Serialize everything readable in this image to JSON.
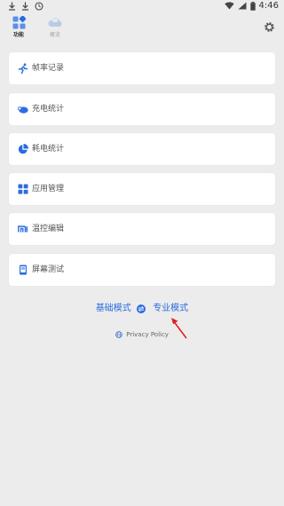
{
  "status_bar": {
    "time": "4:46",
    "notifications": [
      "download-icon",
      "download-icon",
      "clock-icon"
    ]
  },
  "tabs": [
    {
      "label": "功能",
      "icon": "grid-icon",
      "active": true
    },
    {
      "label": "概览",
      "icon": "cloud-icon",
      "active": false
    }
  ],
  "menu": [
    {
      "label": "帧率记录",
      "icon": "running-icon"
    },
    {
      "label": "充电统计",
      "icon": "battery-cloud-icon"
    },
    {
      "label": "耗电统计",
      "icon": "pie-chart-icon"
    },
    {
      "label": "应用管理",
      "icon": "apps-grid-icon"
    },
    {
      "label": "温控编辑",
      "icon": "mi-icon"
    },
    {
      "label": "屏幕测试",
      "icon": "phone-screen-icon"
    }
  ],
  "mode": {
    "basic_label": "基础模式",
    "pro_label": "专业模式"
  },
  "privacy": {
    "label": "Privacy Policy"
  },
  "colors": {
    "accent": "#2a6de0",
    "background": "#ececec",
    "card": "#ffffff",
    "annotation": "#e02020"
  }
}
